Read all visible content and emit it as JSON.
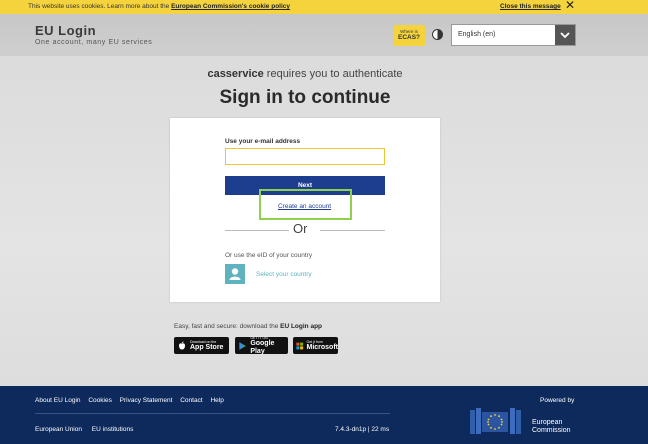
{
  "cookie_banner": {
    "message": "This website uses cookies. Learn more about the ",
    "link": "European Commission's cookie policy",
    "close": "Close this message",
    "close_icon": "close-icon",
    "color": "#f5d33c"
  },
  "header": {
    "title": "EU Login",
    "subtitle": "One account, many EU services",
    "ecas_top": "Where is",
    "ecas_bottom": "ECAS?",
    "contrast_icon": "contrast-icon",
    "language": "English (en)",
    "language_icon": "chevron-down-icon"
  },
  "auth": {
    "service": "casservice",
    "requires": " requires you to authenticate",
    "title": "Sign in to continue"
  },
  "form": {
    "email_label": "Use your e-mail address",
    "email_value": "",
    "next_label": "Next",
    "create_account": "Create an account",
    "or": "Or",
    "eid_text": "Or use the eID of your country",
    "eid_link": "Select your country",
    "eid_icon": "person-icon",
    "accent": "#1d3d8f",
    "highlight_color": "#8fd14f"
  },
  "app": {
    "text": "Easy, fast and secure: download the ",
    "app_name": "EU Login app",
    "badges": [
      {
        "small": "Download on the",
        "big": "App Store",
        "icon": "apple-icon"
      },
      {
        "small": "GET IT ON",
        "big": "Google Play",
        "icon": "google-play-icon"
      },
      {
        "small": "Get it from",
        "big": "Microsoft",
        "icon": "microsoft-icon"
      }
    ]
  },
  "footer": {
    "links": [
      "About EU Login",
      "Cookies",
      "Privacy Statement",
      "Contact",
      "Help"
    ],
    "bottom_links": [
      "European Union",
      "EU institutions"
    ],
    "version": "7.4.3-dn1p | 22 ms",
    "powered_by": "Powered by",
    "ec_line1": "European",
    "ec_line2": "Commission",
    "color": "#0e2a5c"
  }
}
